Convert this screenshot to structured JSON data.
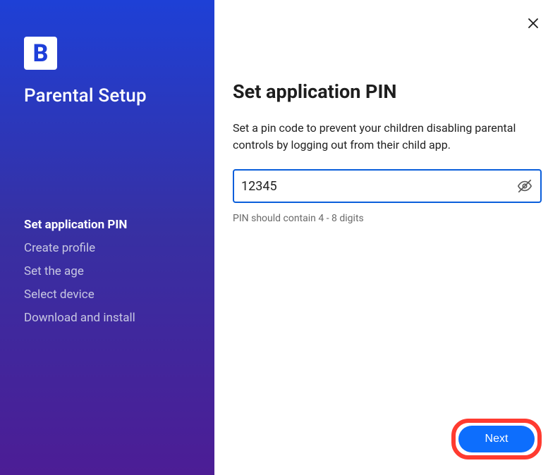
{
  "sidebar": {
    "logo_letter": "B",
    "title": "Parental Setup",
    "steps": [
      {
        "label": "Set application PIN",
        "active": true
      },
      {
        "label": "Create profile",
        "active": false
      },
      {
        "label": "Set the age",
        "active": false
      },
      {
        "label": "Select device",
        "active": false
      },
      {
        "label": "Download and install",
        "active": false
      }
    ]
  },
  "main": {
    "title": "Set application PIN",
    "description": "Set a pin code to prevent your children disabling parental controls by logging out from their child app.",
    "pin_value": "12345",
    "pin_placeholder": "",
    "helper": "PIN should contain 4 - 8 digits",
    "next_label": "Next"
  },
  "icons": {
    "close": "close-icon",
    "eye_off": "eye-off-icon"
  }
}
